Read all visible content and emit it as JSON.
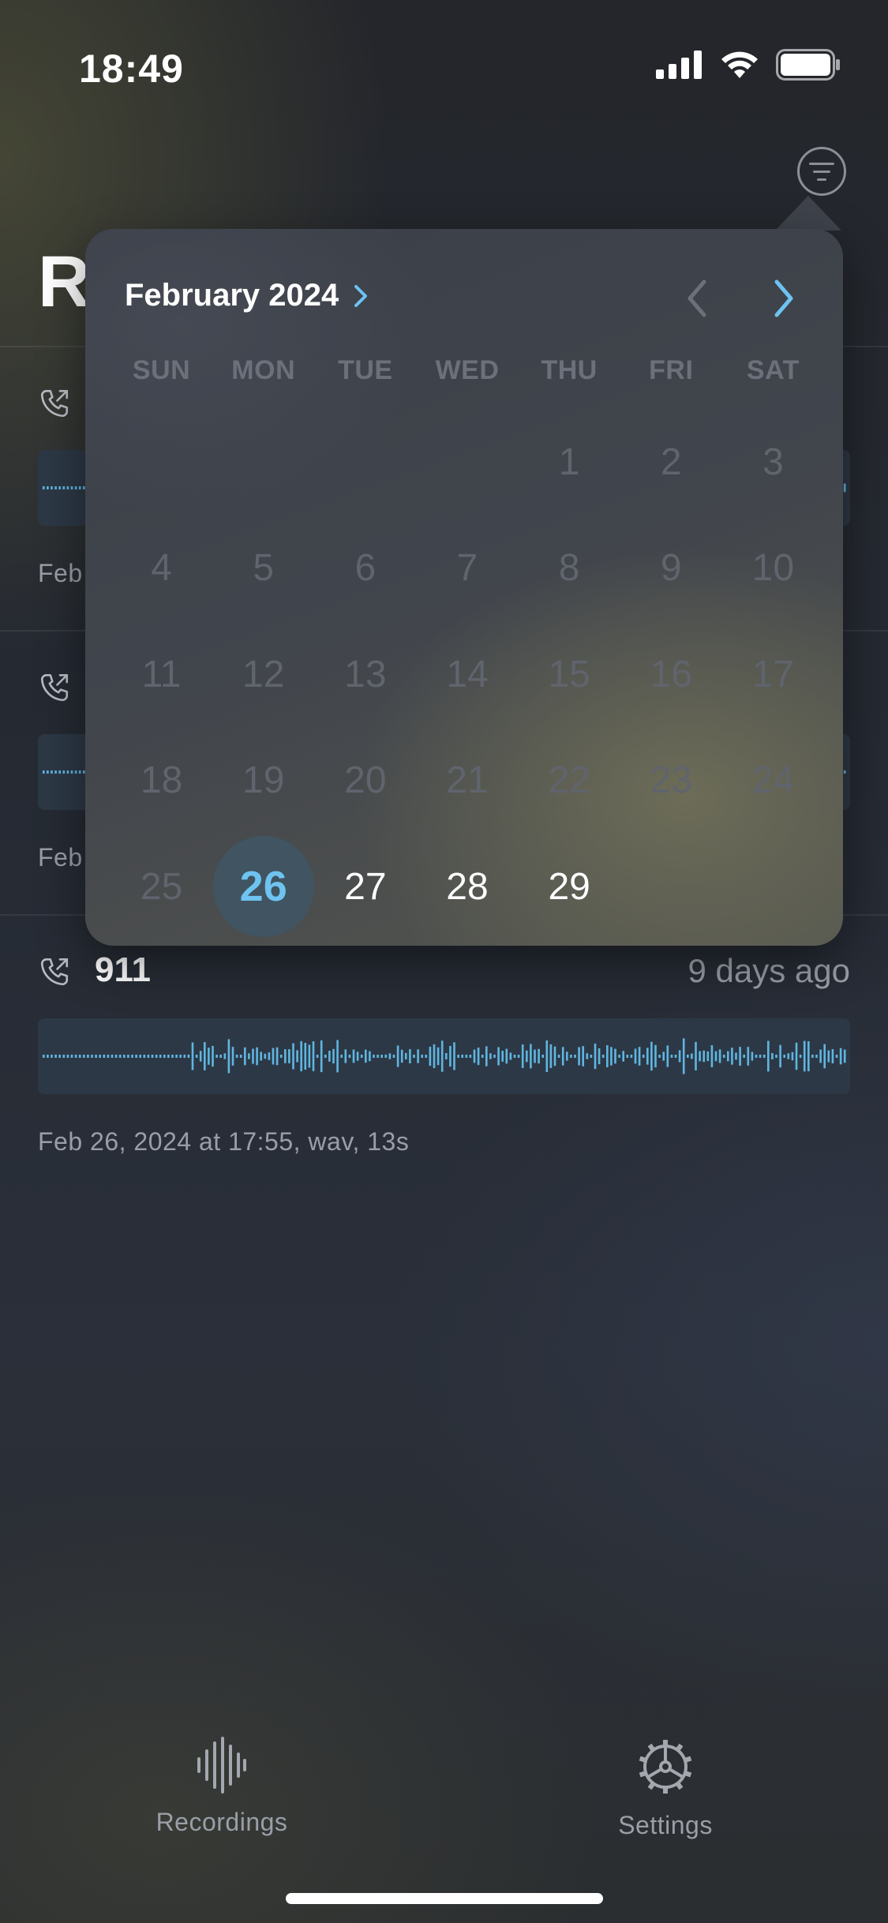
{
  "status_bar": {
    "time": "18:49"
  },
  "header": {
    "title_visible": "R"
  },
  "recordings": [
    {
      "number": "",
      "age": "",
      "meta": "Feb"
    },
    {
      "number": "",
      "age": "",
      "meta": "Feb"
    },
    {
      "number": "911",
      "age": "9 days ago",
      "meta": "Feb 26, 2024 at 17:55, wav, 13s"
    }
  ],
  "calendar": {
    "month_label": "February 2024",
    "weekdays": [
      "SUN",
      "MON",
      "TUE",
      "WED",
      "THU",
      "FRI",
      "SAT"
    ],
    "leading_blanks": 4,
    "days": [
      "1",
      "2",
      "3",
      "4",
      "5",
      "6",
      "7",
      "8",
      "9",
      "10",
      "11",
      "12",
      "13",
      "14",
      "15",
      "16",
      "17",
      "18",
      "19",
      "20",
      "21",
      "22",
      "23",
      "24",
      "25",
      "26",
      "27",
      "28",
      "29"
    ],
    "selected_day": "26",
    "enabled_days": [
      "26",
      "27",
      "28",
      "29"
    ]
  },
  "tab_bar": {
    "recordings_label": "Recordings",
    "settings_label": "Settings"
  },
  "colors": {
    "accent": "#6ec3f0",
    "waveform": "#5fb6e0",
    "muted_text": "#9a9ea7"
  },
  "icons": {
    "filter": "filter-icon",
    "call": "outgoing-call-icon",
    "recordings_tab": "waveform-icon",
    "settings_tab": "gear-icon"
  }
}
